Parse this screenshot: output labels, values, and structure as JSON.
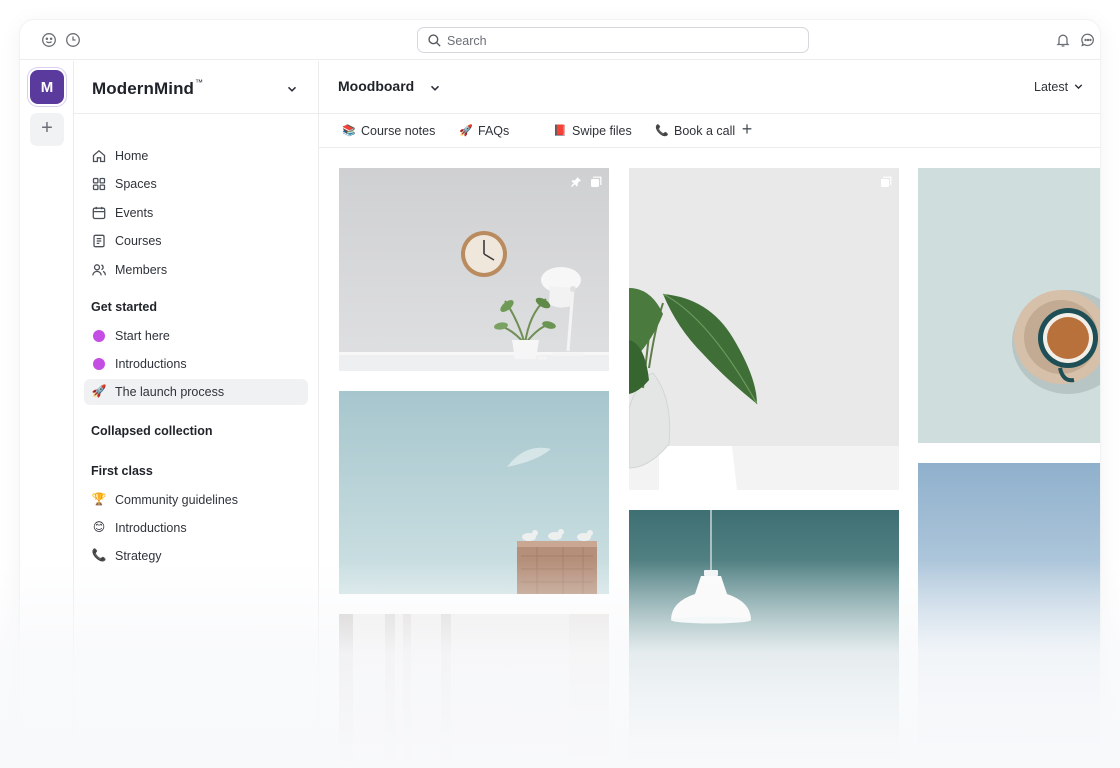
{
  "topbar": {
    "search_placeholder": "Search",
    "icons": [
      "emoji-icon",
      "clock-icon",
      "bell-icon",
      "chat-icon"
    ]
  },
  "rail": {
    "workspace_initial": "M",
    "workspace_color": "#5b3a9e",
    "add_label": "+"
  },
  "sidebar": {
    "brand": "ModernMind",
    "brand_mark": "™",
    "nav": [
      {
        "label": "Home",
        "icon": "home-icon"
      },
      {
        "label": "Spaces",
        "icon": "grid-icon"
      },
      {
        "label": "Events",
        "icon": "calendar-icon"
      },
      {
        "label": "Courses",
        "icon": "book-icon"
      },
      {
        "label": "Members",
        "icon": "users-icon"
      }
    ],
    "sections": [
      {
        "title": "Get started",
        "items": [
          {
            "label": "Start here",
            "icon": "purple-dot",
            "color": "#c44ee3"
          },
          {
            "label": "Introductions",
            "icon": "purple-dot",
            "color": "#c44ee3"
          },
          {
            "label": "The launch process",
            "icon": "rocket-icon",
            "emoji": "🚀",
            "active": true
          }
        ]
      },
      {
        "title": "Collapsed collection",
        "items": []
      },
      {
        "title": "First class",
        "items": [
          {
            "label": "Community guidelines",
            "icon": "trophy-icon",
            "emoji": "🏆"
          },
          {
            "label": "Introductions",
            "icon": "smile-icon",
            "emoji": "😊"
          },
          {
            "label": "Strategy",
            "icon": "phone-icon",
            "emoji": "📞"
          }
        ]
      }
    ]
  },
  "main": {
    "title": "Moodboard",
    "sort_label": "Latest",
    "tabs": [
      {
        "label": "Course notes",
        "emoji": "📚",
        "icon": "books-icon"
      },
      {
        "label": "FAQs",
        "emoji": "🚀",
        "icon": "rocket-icon"
      },
      {
        "label": "Swipe files",
        "emoji": "📕",
        "icon": "red-book-icon"
      },
      {
        "label": "Book a call",
        "emoji": "📞",
        "icon": "phone-icon"
      }
    ],
    "add_tab_label": "+",
    "cards": [
      {
        "subject": "clock-and-lamp-photo",
        "pinned": true
      },
      {
        "subject": "plant-in-vase-photo"
      },
      {
        "subject": "coffee-cup-photo"
      },
      {
        "subject": "birds-on-wall-photo"
      },
      {
        "subject": "pendant-lamp-photo"
      },
      {
        "subject": "blue-sky-photo"
      },
      {
        "subject": "window-photo"
      }
    ]
  }
}
